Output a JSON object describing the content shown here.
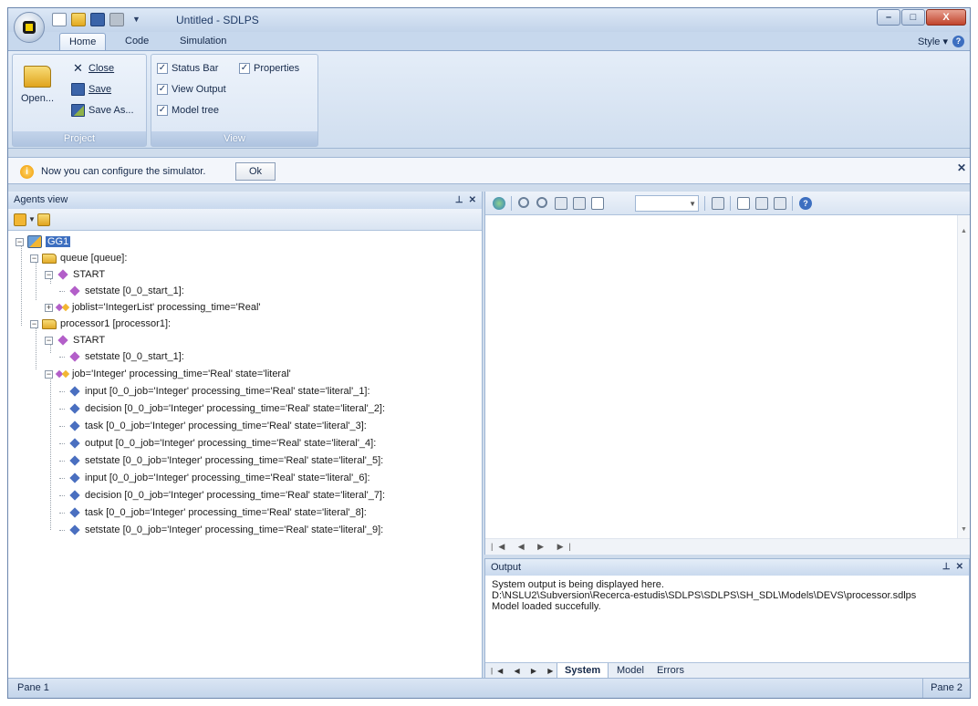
{
  "window": {
    "title": "Untitled - SDLPS"
  },
  "ribbon": {
    "tabs": [
      "Home",
      "Code",
      "Simulation"
    ],
    "style_label": "Style",
    "project": {
      "open_label": "Open...",
      "close_label": "Close",
      "save_label": "Save",
      "save_as_label": "Save As...",
      "group_label": "Project"
    },
    "view": {
      "status_bar_label": "Status Bar",
      "properties_label": "Properties",
      "view_output_label": "View Output",
      "model_tree_label": "Model tree",
      "group_label": "View",
      "status_bar_checked": true,
      "properties_checked": true,
      "view_output_checked": true,
      "model_tree_checked": true
    }
  },
  "infobar": {
    "message": "Now you can configure the simulator.",
    "ok_label": "Ok"
  },
  "agents_view": {
    "title": "Agents view",
    "tree": [
      "GG1",
      "queue [queue]:",
      "START",
      "setstate [0_0_start_1]:",
      "joblist='IntegerList' processing_time='Real'",
      "processor1 [processor1]:",
      "START",
      "setstate [0_0_start_1]:",
      "job='Integer' processing_time='Real' state='literal'",
      "input [0_0_job='Integer' processing_time='Real' state='literal'_1]:",
      "decision [0_0_job='Integer' processing_time='Real' state='literal'_2]:",
      "task [0_0_job='Integer' processing_time='Real' state='literal'_3]:",
      "output [0_0_job='Integer' processing_time='Real' state='literal'_4]:",
      "setstate [0_0_job='Integer' processing_time='Real' state='literal'_5]:",
      "input [0_0_job='Integer' processing_time='Real' state='literal'_6]:",
      "decision [0_0_job='Integer' processing_time='Real' state='literal'_7]:",
      "task [0_0_job='Integer' processing_time='Real' state='literal'_8]:",
      "setstate [0_0_job='Integer' processing_time='Real' state='literal'_9]:"
    ]
  },
  "output": {
    "title": "Output",
    "lines": [
      "System output is being displayed here.",
      "D:\\NSLU2\\Subversion\\Recerca-estudis\\SDLPS\\SDLPS\\SH_SDL\\Models\\DEVS\\processor.sdlps",
      "Model loaded succefully."
    ],
    "tabs": [
      "System",
      "Model",
      "Errors"
    ]
  },
  "statusbar": {
    "left": "Pane 1",
    "right": "Pane 2"
  },
  "colors": {
    "accent": "#3d6fc0",
    "ribbon": "#cfdcec"
  }
}
